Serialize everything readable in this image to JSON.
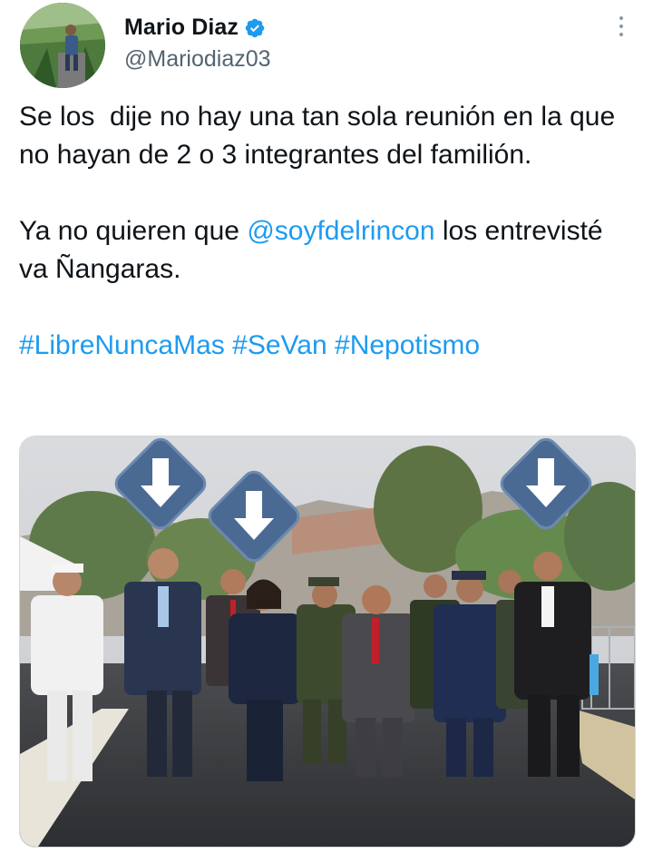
{
  "author": {
    "display_name": "Mario Diaz",
    "handle": "@Mariodiaz03",
    "verified": true,
    "avatar_icon": "profile-photo"
  },
  "tweet": {
    "line1": "Se los  dije no hay una tan sola reunión en la que no hayan de 2 o 3 integrantes del familión.",
    "line2_before": "Ya no quieren que ",
    "mention": "@soyfdelrincon",
    "line2_after": " los entrevisté va Ñangaras.",
    "hashtags": [
      "#LibreNuncaMas",
      "#SeVan",
      "#Nepotismo"
    ]
  },
  "media": {
    "description_icon": "photo",
    "arrow_icon": "down-arrow-icon"
  },
  "colors": {
    "link": "#1d9bf0",
    "verified": "#1d9bf0",
    "text": "#0f1419",
    "secondary": "#536471",
    "arrow_fill": "#4a6a93"
  }
}
